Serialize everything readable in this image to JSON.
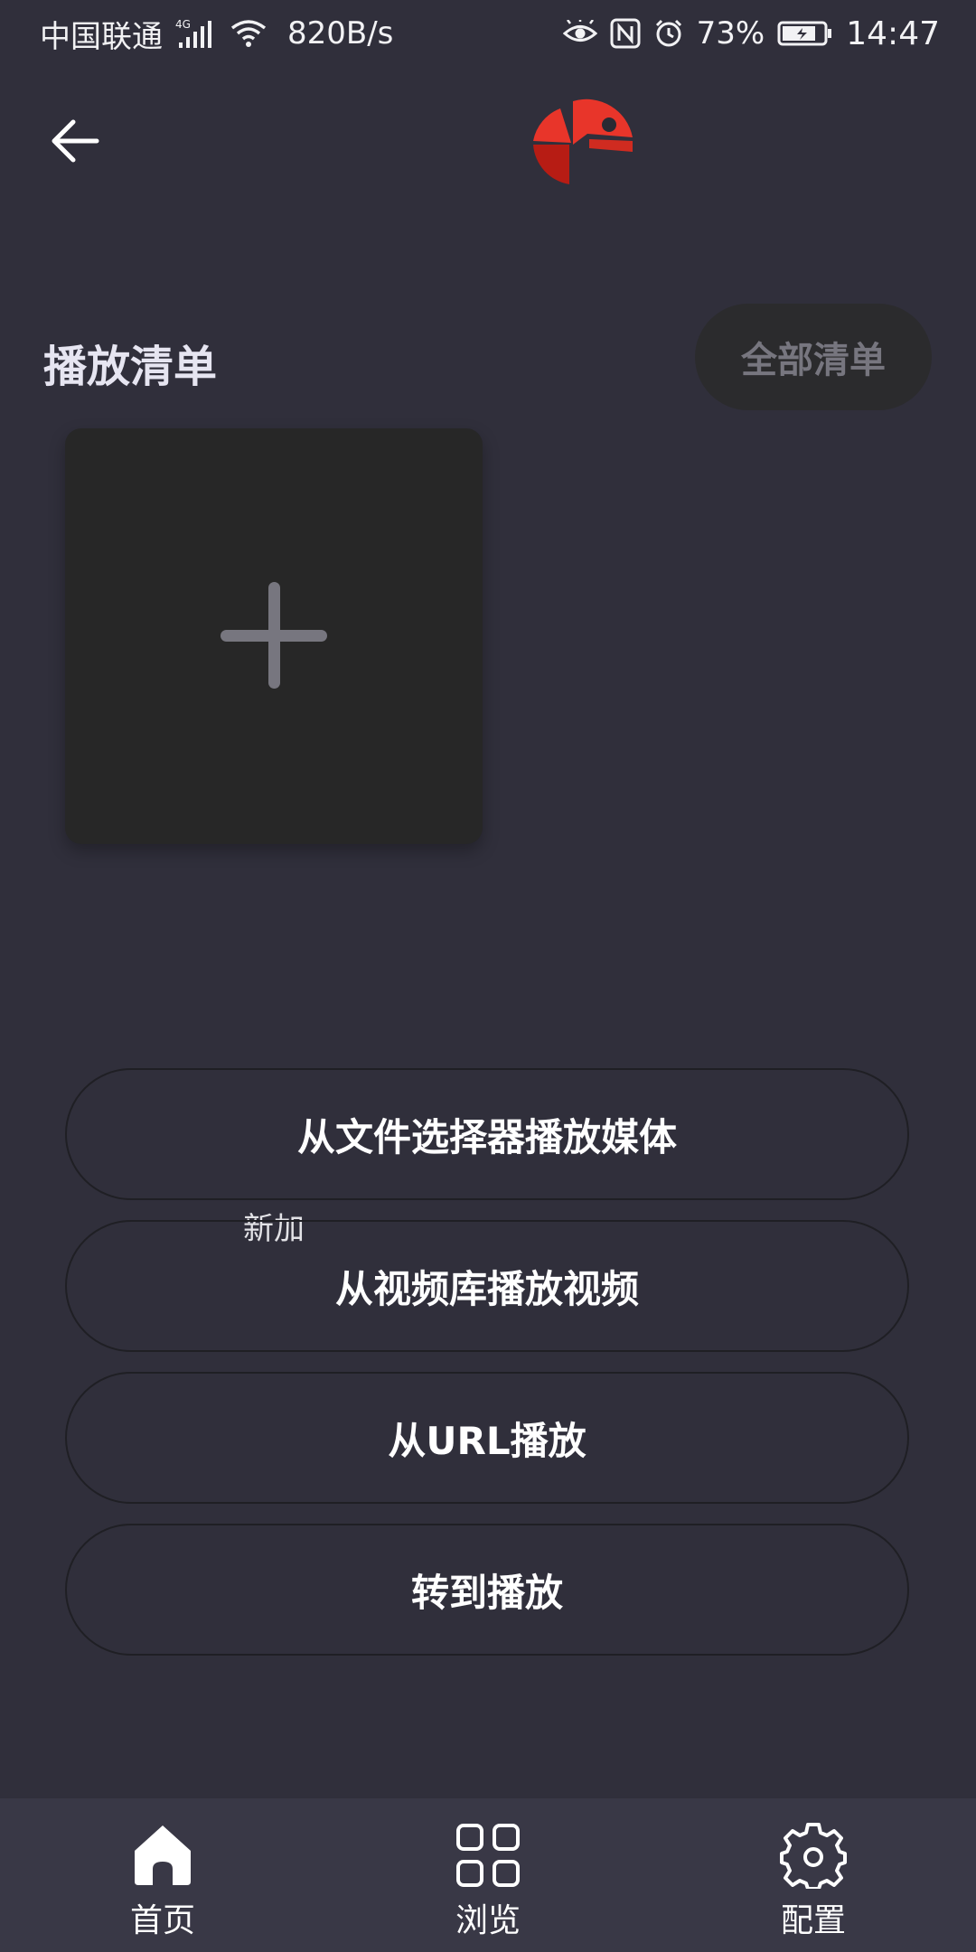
{
  "status_bar": {
    "carrier": "中国联通",
    "network_type": "4G",
    "speed": "820B/s",
    "battery_percent": "73%",
    "time": "14:47",
    "icons": [
      "signal-icon",
      "wifi-icon",
      "eye-icon",
      "nfc-icon",
      "alarm-icon",
      "battery-icon"
    ]
  },
  "header": {
    "back_icon": "arrow-left-icon",
    "logo": "app-logo"
  },
  "playlists": {
    "title": "播放清单",
    "all_button_label": "全部清单",
    "add_card_label": "新加",
    "add_icon": "plus-icon"
  },
  "actions": [
    {
      "label": "从文件选择器播放媒体"
    },
    {
      "label": "从视频库播放视频"
    },
    {
      "label": "从URL播放"
    },
    {
      "label": "转到播放"
    }
  ],
  "bottom_nav": [
    {
      "label": "首页",
      "icon": "home-icon"
    },
    {
      "label": "浏览",
      "icon": "grid-icon"
    },
    {
      "label": "配置",
      "icon": "gear-icon"
    }
  ],
  "colors": {
    "background": "#302f3b",
    "nav_background": "#393846",
    "card_background": "#272727",
    "logo_red": "#e8352a",
    "logo_dark_red": "#b71c14"
  }
}
